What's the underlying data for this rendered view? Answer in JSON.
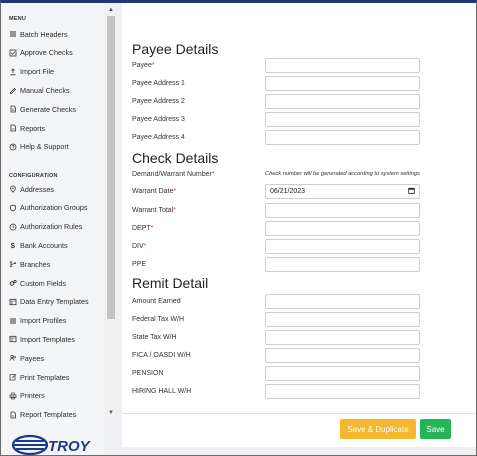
{
  "sidebar": {
    "menu_label": "MENU",
    "menu_items": [
      {
        "label": "Batch Headers",
        "icon": "list-icon"
      },
      {
        "label": "Approve Checks",
        "icon": "check-square-icon"
      },
      {
        "label": "Import File",
        "icon": "upload-icon"
      },
      {
        "label": "Manual Checks",
        "icon": "pen-icon"
      },
      {
        "label": "Generate Checks",
        "icon": "document-icon"
      },
      {
        "label": "Reports",
        "icon": "report-icon"
      },
      {
        "label": "Help & Support",
        "icon": "help-icon"
      }
    ],
    "config_label": "CONFIGURATION",
    "config_items": [
      {
        "label": "Addresses",
        "icon": "location-icon"
      },
      {
        "label": "Authorization Groups",
        "icon": "shield-icon"
      },
      {
        "label": "Authorization Rules",
        "icon": "clock-icon"
      },
      {
        "label": "Bank Accounts",
        "icon": "dollar-icon"
      },
      {
        "label": "Branches",
        "icon": "branch-icon"
      },
      {
        "label": "Custom Fields",
        "icon": "gears-icon"
      },
      {
        "label": "Data Entry Templates",
        "icon": "template-icon"
      },
      {
        "label": "Import Profiles",
        "icon": "list-icon"
      },
      {
        "label": "Import Templates",
        "icon": "template-icon"
      },
      {
        "label": "Payees",
        "icon": "people-icon"
      },
      {
        "label": "Print Templates",
        "icon": "edit-icon"
      },
      {
        "label": "Printers",
        "icon": "printer-icon"
      },
      {
        "label": "Report Templates",
        "icon": "report-icon"
      }
    ],
    "logo_text": "TROY"
  },
  "payee": {
    "title": "Payee Details",
    "fields": [
      {
        "label": "Payee",
        "required": true,
        "value": ""
      },
      {
        "label": "Payee Address 1",
        "required": false,
        "value": ""
      },
      {
        "label": "Payee Address 2",
        "required": false,
        "value": ""
      },
      {
        "label": "Payee Address 3",
        "required": false,
        "value": ""
      },
      {
        "label": "Payee Address 4",
        "required": false,
        "value": ""
      }
    ]
  },
  "check": {
    "title": "Check Details",
    "number_label": "Demand/Warrant Number",
    "number_note": "Check number will be generated according to system settings",
    "fields": [
      {
        "label": "Warrant Date",
        "required": true,
        "value": "06/21/2023"
      },
      {
        "label": "Warrant Total",
        "required": true,
        "value": ""
      },
      {
        "label": "DEPT",
        "required": true,
        "value": ""
      },
      {
        "label": "DIV",
        "required": true,
        "value": ""
      },
      {
        "label": "PPE",
        "required": false,
        "value": ""
      }
    ]
  },
  "remit": {
    "title": "Remit Detail",
    "fields": [
      {
        "label": "Amount Earned",
        "value": ""
      },
      {
        "label": "Federal Tax W/H",
        "value": ""
      },
      {
        "label": "State Tax W/H",
        "value": ""
      },
      {
        "label": "FICA / OASDI W/H",
        "value": ""
      },
      {
        "label": "PENSION",
        "value": ""
      },
      {
        "label": "HIRING HALL W/H",
        "value": ""
      }
    ]
  },
  "actions": {
    "save_duplicate_label": "Save & Duplicate",
    "save_label": "Save"
  },
  "colors": {
    "save_duplicate": "#f5b72d",
    "save": "#25b457",
    "required_star": "#e03a3a",
    "logo": "#1d3a8a"
  }
}
